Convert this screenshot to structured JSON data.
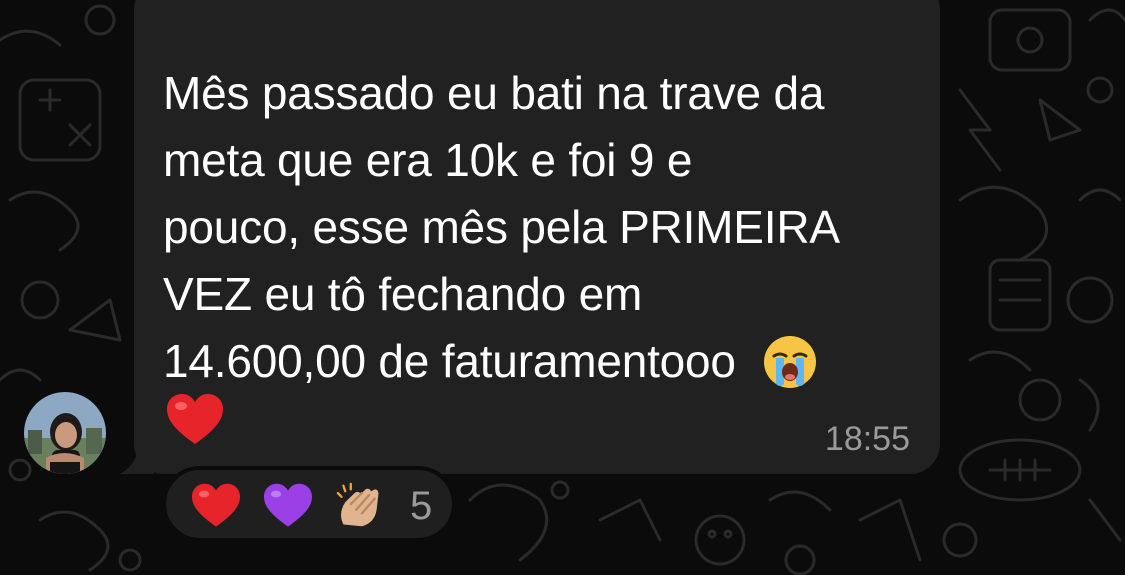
{
  "chat": {
    "message": {
      "lines": [
        "Mês passado eu bati na trave da",
        "meta que era 10k e foi 9 e",
        "pouco, esse mês pela PRIMEIRA",
        "VEZ eu tô fechando em",
        "14.600,00 de faturamentooo"
      ],
      "emoji_inline": "loudly-crying-face-emoji",
      "emoji_trailing": "red-heart-emoji",
      "time": "18:55"
    },
    "reactions": {
      "emojis": [
        "red-heart-emoji",
        "purple-heart-emoji",
        "clapping-hands-emoji"
      ],
      "count": "5"
    },
    "avatar": "profile-photo",
    "colors": {
      "background": "#0b0b0b",
      "bubble": "#212121",
      "text": "#ffffff",
      "meta": "#9a9a9a"
    }
  }
}
